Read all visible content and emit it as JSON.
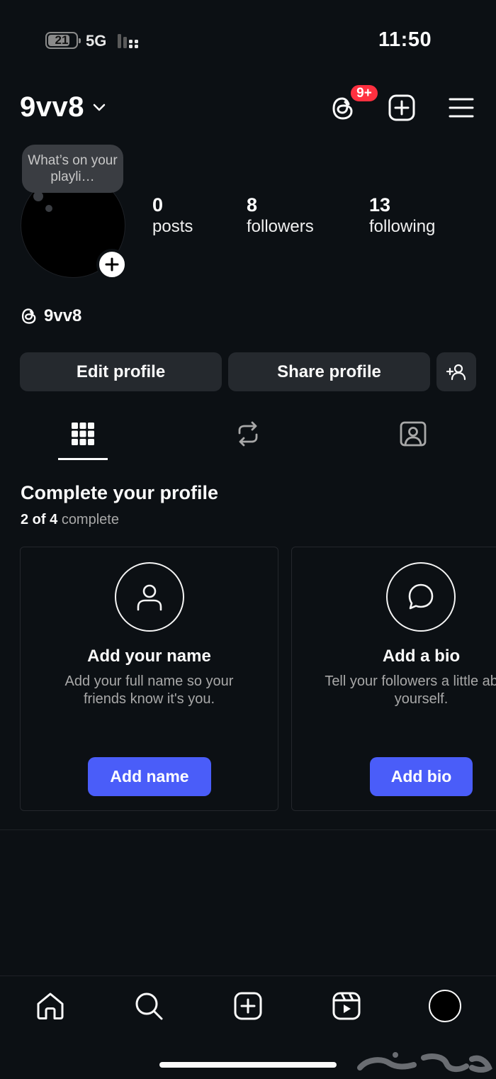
{
  "status_bar": {
    "battery": "21",
    "network": "5G",
    "time": "11:50"
  },
  "header": {
    "username": "9vv8",
    "threads_badge": "9+"
  },
  "profile": {
    "note_bubble": "What’s on your playli…",
    "stats": [
      {
        "count": "0",
        "label": "posts"
      },
      {
        "count": "8",
        "label": "followers"
      },
      {
        "count": "13",
        "label": "following"
      }
    ],
    "threads_handle": "9vv8"
  },
  "actions": {
    "edit_profile": "Edit profile",
    "share_profile": "Share profile"
  },
  "complete_profile": {
    "title": "Complete your profile",
    "progress_count": "2 of 4",
    "progress_label": "complete",
    "cards": [
      {
        "title": "Add your name",
        "description": "Add your full name so your friends know it's you.",
        "button": "Add name",
        "icon": "person-icon"
      },
      {
        "title": "Add a bio",
        "description": "Tell your followers a little about yourself.",
        "button": "Add bio",
        "icon": "chat-bubble-icon"
      }
    ]
  },
  "bottom_nav": [
    "home-icon",
    "search-icon",
    "create-icon",
    "reels-icon",
    "profile-avatar"
  ],
  "colors": {
    "background": "#0c1014",
    "button": "#25292e",
    "primary": "#4a5df9",
    "badge": "#ff3040"
  }
}
